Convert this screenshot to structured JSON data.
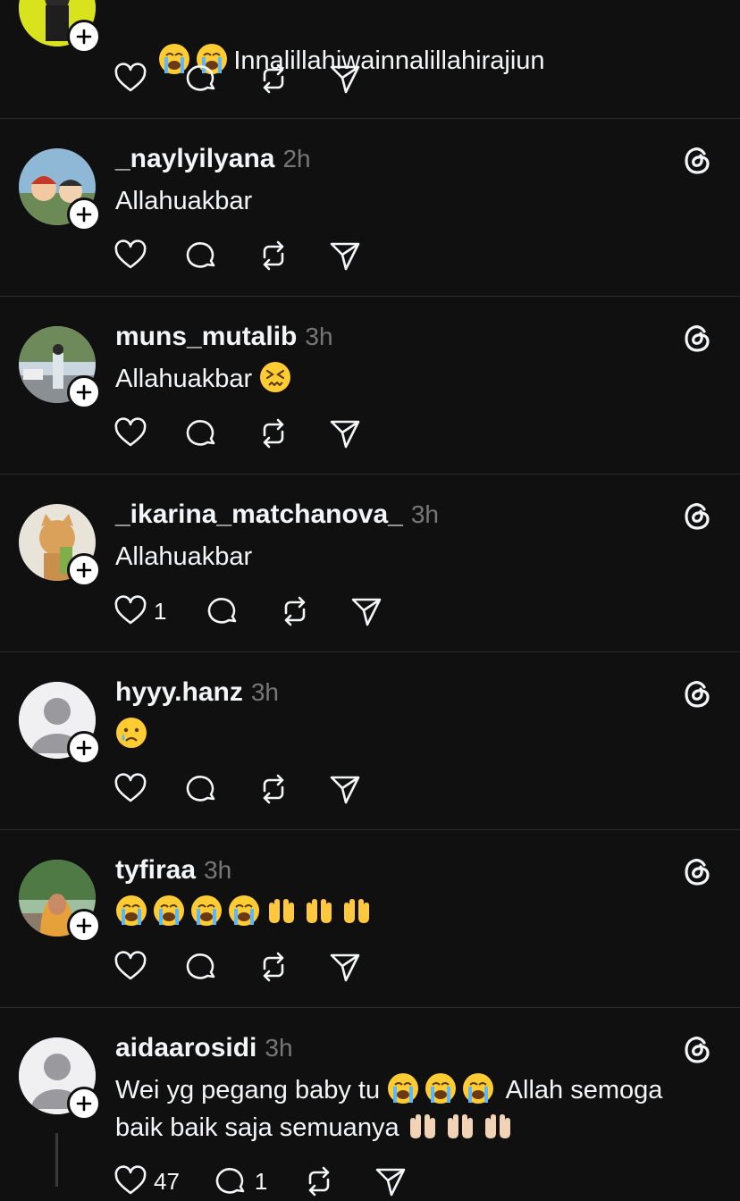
{
  "colors": {
    "background": "#101010",
    "text": "#f3f5f7",
    "muted": "#777777",
    "divider": "#2b2b2b"
  },
  "posts": [
    {
      "id": "p0",
      "username": "",
      "time": "",
      "text_emojis_before": [
        "loudly-crying-face-emoji",
        "loudly-crying-face-emoji"
      ],
      "text": "Innalillahiwainnalillahirajiun",
      "likes": "",
      "replies": "",
      "avatar": "yellow-photo-avatar"
    },
    {
      "id": "p1",
      "username": "_naylyilyana",
      "time": "2h",
      "text": "Allahuakbar",
      "likes": "",
      "replies": "",
      "avatar": "cartoon-avatar"
    },
    {
      "id": "p2",
      "username": "muns_mutalib",
      "time": "3h",
      "text": "Allahuakbar",
      "text_emojis_after": [
        "confounded-face-emoji"
      ],
      "likes": "",
      "replies": "",
      "avatar": "outdoor-photo-avatar"
    },
    {
      "id": "p3",
      "username": "_ikarina_matchanova_",
      "time": "3h",
      "text": "Allahuakbar",
      "likes": "1",
      "replies": "",
      "avatar": "cat-avatar"
    },
    {
      "id": "p4",
      "username": "hyyy.hanz",
      "time": "3h",
      "text": "",
      "text_emojis_after": [
        "crying-face-emoji"
      ],
      "likes": "",
      "replies": "",
      "avatar": "default-avatar"
    },
    {
      "id": "p5",
      "username": "tyfiraa",
      "time": "3h",
      "text": "",
      "likes": "",
      "replies": "",
      "avatar": "hijab-photo-avatar"
    },
    {
      "id": "p6",
      "username": "aidaarosidi",
      "time": "3h",
      "text_line1": "Wei yg pegang baby tu",
      "text_line1_after": "Allah semoga",
      "text_line2": "baik baik saja semuanya",
      "likes": "47",
      "replies": "1",
      "avatar": "default-avatar"
    }
  ]
}
